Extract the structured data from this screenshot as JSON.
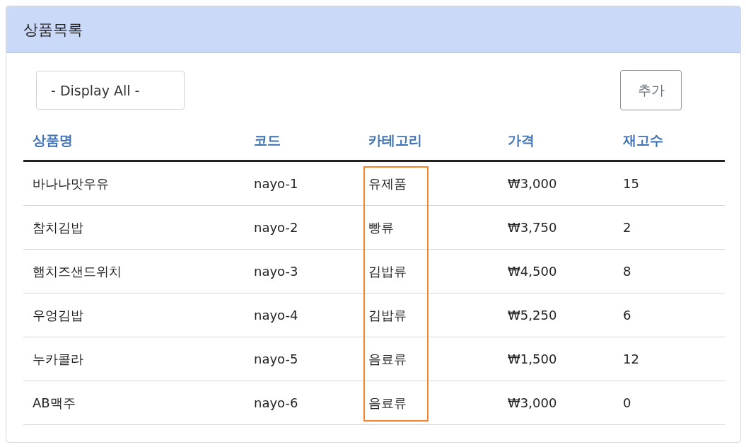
{
  "panel": {
    "title": "상품목록"
  },
  "filter": {
    "value": "- Display All -"
  },
  "add_button": {
    "label": "추가"
  },
  "table": {
    "columns": [
      {
        "label": "상품명",
        "highlighted": false
      },
      {
        "label": "코드",
        "highlighted": false
      },
      {
        "label": "카테고리",
        "highlighted": true
      },
      {
        "label": "가격",
        "highlighted": false
      },
      {
        "label": "재고수",
        "highlighted": false
      }
    ],
    "rows": [
      [
        "바나나맛우유",
        "nayo-1",
        "유제품",
        "₩3,000",
        "15"
      ],
      [
        "참치김밥",
        "nayo-2",
        "빵류",
        "₩3,750",
        "2"
      ],
      [
        "햄치즈샌드위치",
        "nayo-3",
        "김밥류",
        "₩4,500",
        "8"
      ],
      [
        "우엉김밥",
        "nayo-4",
        "김밥류",
        "₩5,250",
        "6"
      ],
      [
        "누카콜라",
        "nayo-5",
        "음료류",
        "₩1,500",
        "12"
      ],
      [
        "AB맥주",
        "nayo-6",
        "음료류",
        "₩3,000",
        "0"
      ]
    ]
  }
}
